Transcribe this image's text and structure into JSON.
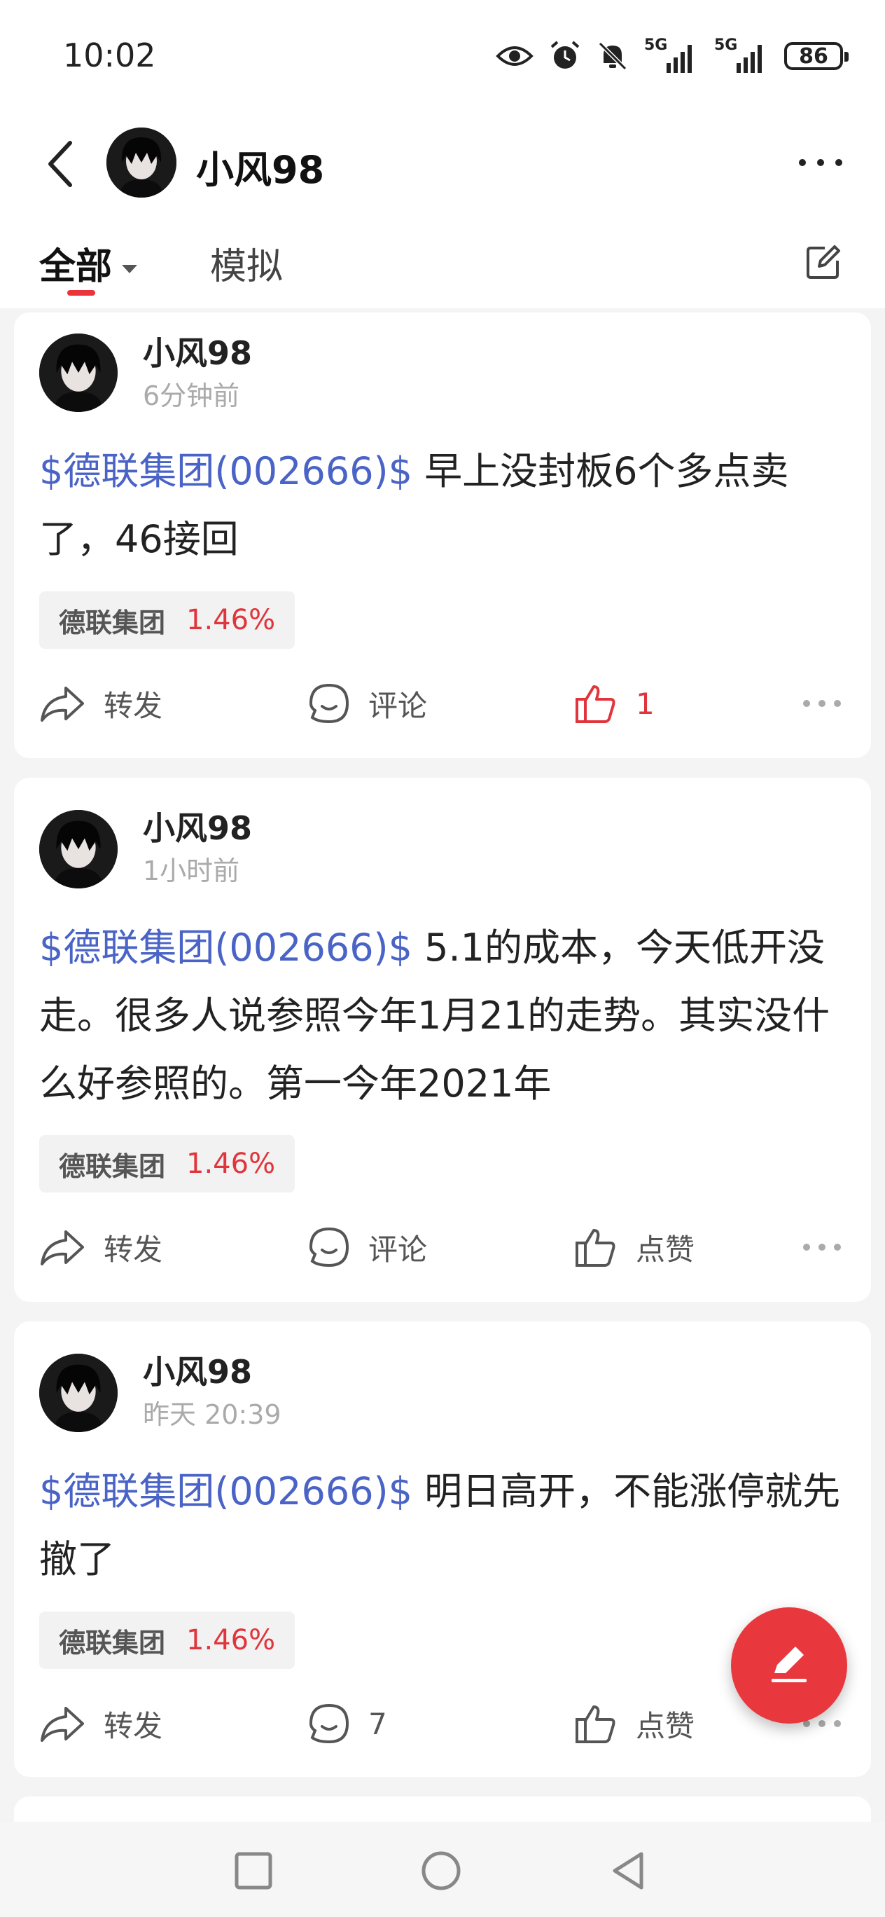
{
  "status_bar": {
    "time": "10:02",
    "signal_1": "5G",
    "signal_2": "5G",
    "battery": "86"
  },
  "header": {
    "username": "小风98"
  },
  "tabs": {
    "all": "全部",
    "simulated": "模拟"
  },
  "posts": [
    {
      "author": "小风98",
      "time": "6分钟前",
      "tag": "$德联集团(002666)$",
      "text": " 早上没封板6个多点卖了，46接回",
      "stock_name": "德联集团",
      "stock_change": "1.46%",
      "share_label": "转发",
      "comment_label": "评论",
      "like_label": "1"
    },
    {
      "author": "小风98",
      "time": "1小时前",
      "tag": "$德联集团(002666)$",
      "text": " 5.1的成本，今天低开没走。很多人说参照今年1月21的走势。其实没什么好参照的。第一今年2021年",
      "stock_name": "德联集团",
      "stock_change": "1.46%",
      "share_label": "转发",
      "comment_label": "评论",
      "like_label": "点赞"
    },
    {
      "author": "小风98",
      "time": "昨天 20:39",
      "tag": "$德联集团(002666)$",
      "text": " 明日高开，不能涨停就先撤了",
      "stock_name": "德联集团",
      "stock_change": "1.46%",
      "share_label": "转发",
      "comment_label": "7",
      "like_label": "点赞"
    }
  ],
  "colors": {
    "accent_red": "#e0353c",
    "link_blue": "#4a63c6",
    "background": "#f4f4f4"
  }
}
